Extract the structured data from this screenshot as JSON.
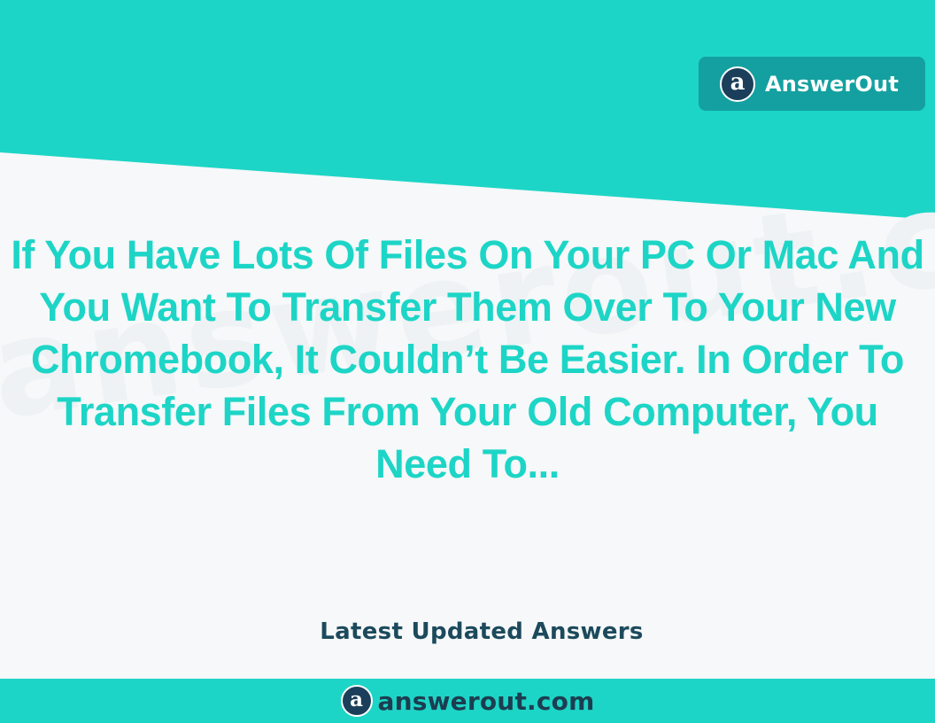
{
  "brand": {
    "logo_letter": "a",
    "name": "AnswerOut"
  },
  "watermark": "answerout.com",
  "headline": "If You Have Lots Of Files On Your PC Or Mac And You Want To Transfer Them Over To Your New Chromebook, It Couldn’t Be Easier. In Order To Transfer Files From Your Old Computer, You Need To...",
  "tagline": "Latest Updated Answers",
  "footer": {
    "logo_letter": "a",
    "domain": "answerout.com"
  },
  "colors": {
    "accent": "#1dd5c6",
    "badge": "#14a0a0",
    "logo_circle": "#1b3f5a",
    "dark_text": "#1c4a5c",
    "background": "#f6f8f9"
  }
}
